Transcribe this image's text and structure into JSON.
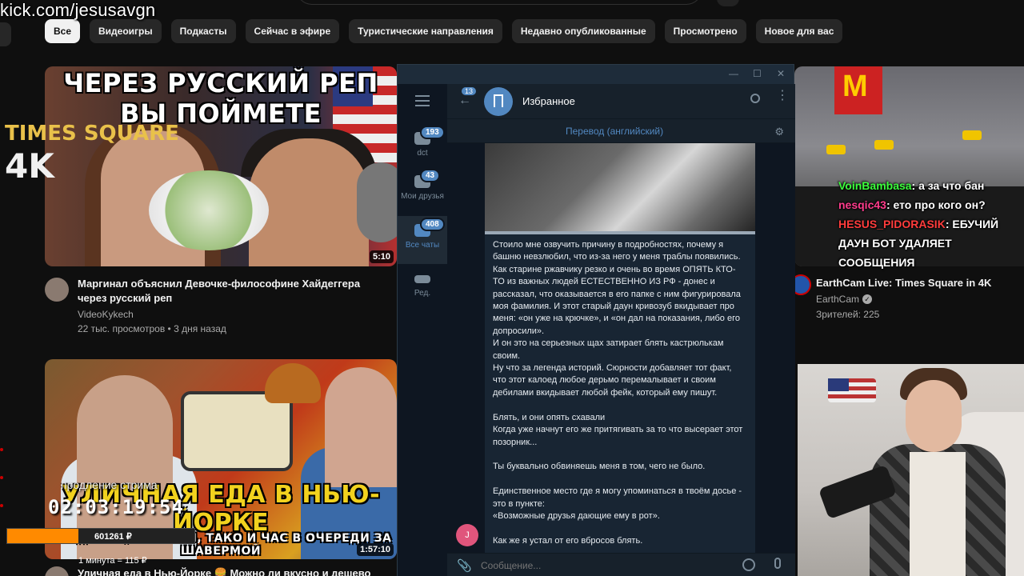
{
  "watermark": "kick.com/jesusavgn",
  "chips": [
    "Все",
    "Видеоигры",
    "Подкасты",
    "Сейчас в эфире",
    "Туристические направления",
    "Недавно опубликованные",
    "Просмотрено",
    "Новое для вас"
  ],
  "video1": {
    "thumb_line1": "ЧЕРЕЗ РУССКИЙ РЕП",
    "thumb_line2": "ВЫ ПОЙМЕТЕ",
    "duration": "5:10",
    "title": "Маргинал объяснил Девочке-философине Хайдеггера через русский реп",
    "channel": "VideoKykech",
    "stats": "22 тыс. просмотров • 3 дня назад"
  },
  "video2": {
    "thumb_line1": "УЛИЧНАЯ ЕДА В НЬЮ-ЙОРКЕ",
    "thumb_line2": "СЭНДВИЧИ, БУРГЕРЫ, ТАКО И ЧАС В ОЧЕРЕДИ ЗА ШАВЕРМОЙ",
    "duration": "1:57:10",
    "title": "Уличная еда в Нью-Йорке 🍔 Можно ли вкусно и дешево"
  },
  "stream_overlay": {
    "extension_label": "продление стрима",
    "timer": "02:03:19:54",
    "donation_amount": "601261 ₽",
    "donation_progress": 0.38,
    "rate": "1 минута = 115 ₽"
  },
  "video3": {
    "board_line1": "TIMES SQUARE",
    "board_line2": "4K",
    "title": "EarthCam Live: Times Square in 4K",
    "channel": "EarthCam",
    "viewers": "Зрителей: 225"
  },
  "chat": [
    {
      "user": "VoinBambasa",
      "color": "#3cff3c",
      "text": ": а за что бан"
    },
    {
      "user": "nesqic43",
      "color": "#ff3c8c",
      "text": ": ето про кого он?"
    },
    {
      "user": "HESUS_PIDORASIK",
      "color": "#ff3c3c",
      "text": ": ЕБУЧИЙ ДАУН БОТ УДАЛЯЕТ СООБЩЕНИЯ"
    }
  ],
  "telegram": {
    "folders": [
      {
        "label": "dct",
        "badge": "193"
      },
      {
        "label": "Мои друзья",
        "badge": "43"
      },
      {
        "label": "Все чаты",
        "badge": "408"
      },
      {
        "label": "Ред.",
        "badge": ""
      }
    ],
    "back_badge": "13",
    "chat_name": "Избранное",
    "translate_label": "Перевод (английский)",
    "message": "Стоило мне озвучить причину в подробностях, почему я башню невзлюбил, что из-за него у меня траблы появились. Как старине ржавчику резко и очень во время ОПЯТЬ КТО-ТО из важных людей ЕСТЕСТВЕННО ИЗ РФ - донес и рассказал, что оказывается в его папке с ним фигурировала моя фамилия. И этот старый даун кривозуб вкидывает про меня: «он уже на крючке», и «он дал на показания, либо его допросили».\nИ он это на серьезных щах затирает блять кастрюлькам своим.\nНу что за легенда историй. Сюрности добавляет тот факт, что этот калоед любое дерьмо перемалывает и своим дебилами вкидывает любой фейк, который ему пишут.\n\nБлять, и они опять схавали\nКогда уже начнут его же притягивать за то что высерает этот позорник...\n\nТы буквально обвиняешь меня в том, чего не было.\n\nЕдинственное место где я могу упоминаться в твоём досье - это в пункте:\n«Возможные друзья дающие ему в рот».\n\nКак же я устал от его вбросов блять.",
    "user_avatar_letter": "J",
    "composer_placeholder": "Сообщение..."
  }
}
